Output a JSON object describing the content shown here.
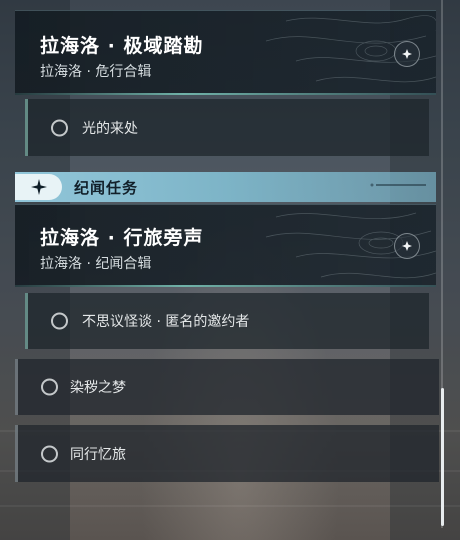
{
  "cards": [
    {
      "title": "拉海洛 · 极域踏勘",
      "subtitle": "拉海洛 · 危行合辑",
      "icon": "star-badge-icon"
    },
    {
      "title": "拉海洛 · 行旅旁声",
      "subtitle": "拉海洛 · 纪闻合辑",
      "icon": "star-badge-icon"
    }
  ],
  "sub_items": [
    {
      "label": "光的来处"
    },
    {
      "label": "不思议怪谈 · 匿名的邀约者"
    }
  ],
  "section": {
    "title": "纪闻任务",
    "icon": "sparkle-icon"
  },
  "tasks": [
    {
      "label": "染秽之梦"
    },
    {
      "label": "同行忆旅"
    }
  ],
  "colors": {
    "section_bar": "#96cde1",
    "accent_line": "#8ce1d2",
    "text_primary": "#ffffff"
  }
}
